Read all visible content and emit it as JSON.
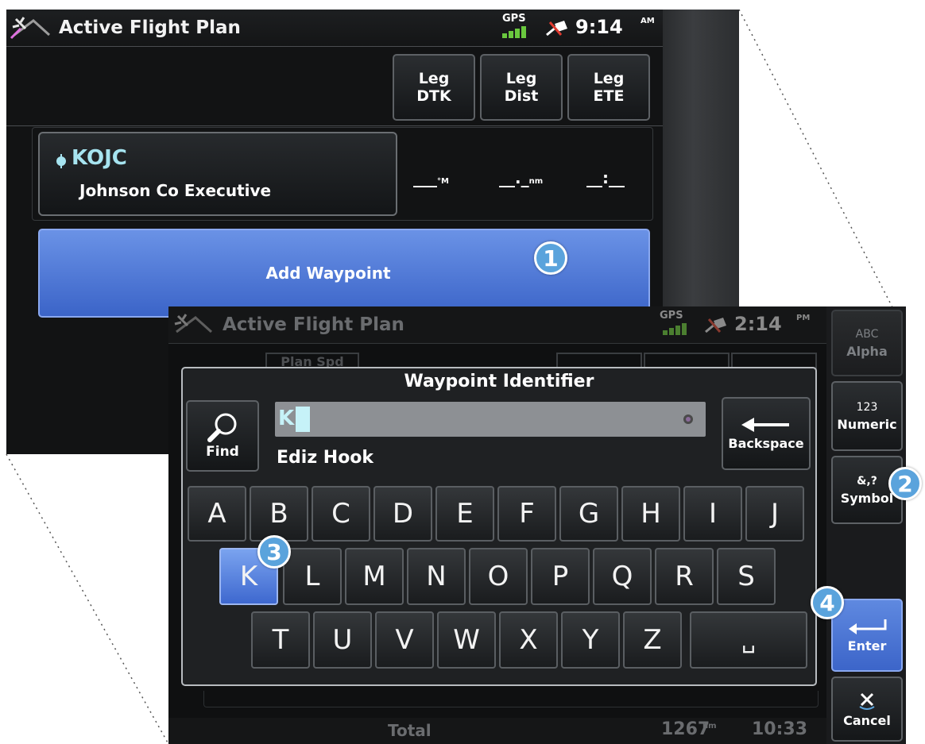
{
  "back_screen": {
    "title": "Active Flight Plan",
    "status": {
      "gps": "GPS",
      "time": "9:14",
      "ampm": "AM"
    },
    "column_buttons": [
      {
        "line1": "Leg",
        "line2": "DTK"
      },
      {
        "line1": "Leg",
        "line2": "Dist"
      },
      {
        "line1": "Leg",
        "line2": "ETE"
      }
    ],
    "waypoint": {
      "ident": "KOJC",
      "name": "Johnson Co Executive"
    },
    "leg_values": {
      "dtk": "___",
      "dtk_unit": "°M",
      "dist": "__._",
      "dist_unit": "nm",
      "ete": "__:__"
    },
    "add_waypoint": "Add Waypoint"
  },
  "front_screen": {
    "title": "Active Flight Plan",
    "status": {
      "gps": "GPS",
      "time": "2:14",
      "ampm": "PM"
    },
    "partial_header": "Plan Spd",
    "dialog_title": "Waypoint Identifier",
    "find_label": "Find",
    "input_value": "K",
    "suggestion": "Ediz Hook",
    "backspace_label": "Backspace",
    "keyboard_rows": [
      [
        "A",
        "B",
        "C",
        "D",
        "E",
        "F",
        "G",
        "H",
        "I",
        "J"
      ],
      [
        "K",
        "L",
        "M",
        "N",
        "O",
        "P",
        "Q",
        "R",
        "S"
      ],
      [
        "T",
        "U",
        "V",
        "W",
        "X",
        "Y",
        "Z",
        "␣"
      ]
    ],
    "selected_key": "K",
    "footer": {
      "label": "Total",
      "distance": "1267",
      "distance_unit": "nm",
      "time": "10:33"
    }
  },
  "sidebar": {
    "alpha": {
      "icon": "ABC",
      "label": "Alpha"
    },
    "numeric": {
      "icon": "123",
      "label": "Numeric"
    },
    "symbol": {
      "icon": "&,?",
      "label": "Symbol"
    },
    "enter": {
      "label": "Enter"
    },
    "cancel": {
      "label": "Cancel"
    }
  },
  "callouts": [
    "1",
    "2",
    "3",
    "4"
  ],
  "colors": {
    "accent_blue": "#4a74d6",
    "callout": "#5aa3dc",
    "highlight_text": "#a6e4f0",
    "input_bg": "#8d9094"
  }
}
